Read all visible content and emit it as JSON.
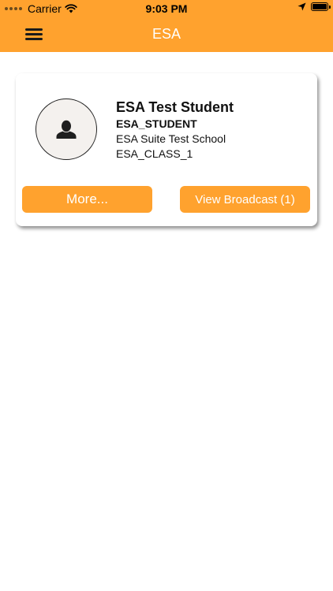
{
  "status_bar": {
    "carrier": "Carrier",
    "time": "9:03 PM",
    "icons": [
      "wifi-icon",
      "location-icon",
      "battery-icon"
    ]
  },
  "nav": {
    "title": "ESA",
    "menu_icon": "hamburger-menu-icon"
  },
  "student_card": {
    "name": "ESA Test Student",
    "student_id": "ESA_STUDENT",
    "school": "ESA Suite Test School",
    "class_name": "ESA_CLASS_1",
    "avatar_icon": "user-silhouette-icon",
    "more_label": "More...",
    "broadcast_label": "View Broadcast (1)"
  },
  "colors": {
    "accent": "#ffa22e",
    "background": "#ffffff"
  }
}
